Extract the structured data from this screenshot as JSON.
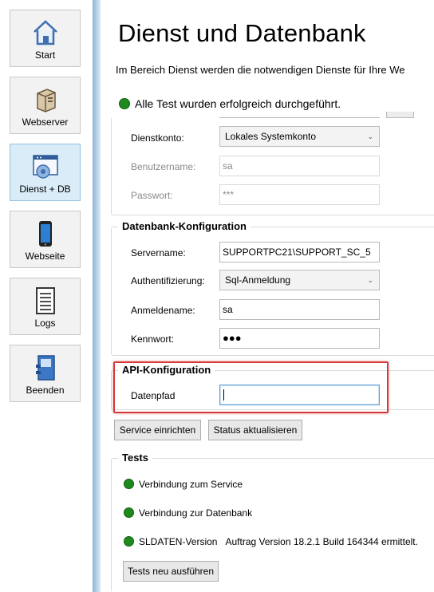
{
  "sidebar": {
    "items": [
      {
        "label": "Start",
        "icon": "home-icon"
      },
      {
        "label": "Webserver",
        "icon": "server-icon"
      },
      {
        "label": "Dienst + DB",
        "icon": "service-db-icon",
        "active": true
      },
      {
        "label": "Webseite",
        "icon": "smartphone-icon"
      },
      {
        "label": "Logs",
        "icon": "log-document-icon"
      },
      {
        "label": "Beenden",
        "icon": "exit-door-icon"
      }
    ]
  },
  "main": {
    "title": "Dienst und Datenbank",
    "description": "Im Bereich Dienst werden die notwendigen Dienste für Ihre We",
    "status": "Alle Test wurden erfolgreich durchgeführt."
  },
  "service": {
    "dienstkonto_label": "Dienstkonto:",
    "dienstkonto_value": "Lokales Systemkonto",
    "benutzername_label": "Benutzername:",
    "benutzername_value": "sa",
    "passwort_label": "Passwort:",
    "passwort_value": "***"
  },
  "database": {
    "title": "Datenbank-Konfiguration",
    "servername_label": "Servername:",
    "servername_value": "SUPPORTPC21\\SUPPORT_SC_5",
    "auth_label": "Authentifizierung:",
    "auth_value": "Sql-Anmeldung",
    "anmeldename_label": "Anmeldename:",
    "anmeldename_value": "sa",
    "kennwort_label": "Kennwort:",
    "kennwort_value": "●●●"
  },
  "api": {
    "title": "API-Konfiguration",
    "datenpfad_label": "Datenpfad",
    "datenpfad_value": ""
  },
  "actions": {
    "service_button": "Service einrichten",
    "status_button": "Status aktualisieren"
  },
  "tests": {
    "title": "Tests",
    "items": [
      {
        "label": "Verbindung zum Service",
        "detail": ""
      },
      {
        "label": "Verbindung zur Datenbank",
        "detail": ""
      },
      {
        "label": "SLDATEN-Version",
        "detail": "Auftrag Version 18.2.1 Build 164344 ermittelt."
      }
    ],
    "rerun_button": "Tests neu ausführen"
  },
  "colors": {
    "ok_green": "#1e8a1e",
    "highlight_red": "#d43a3a",
    "active_nav": "#d9ecf7"
  }
}
